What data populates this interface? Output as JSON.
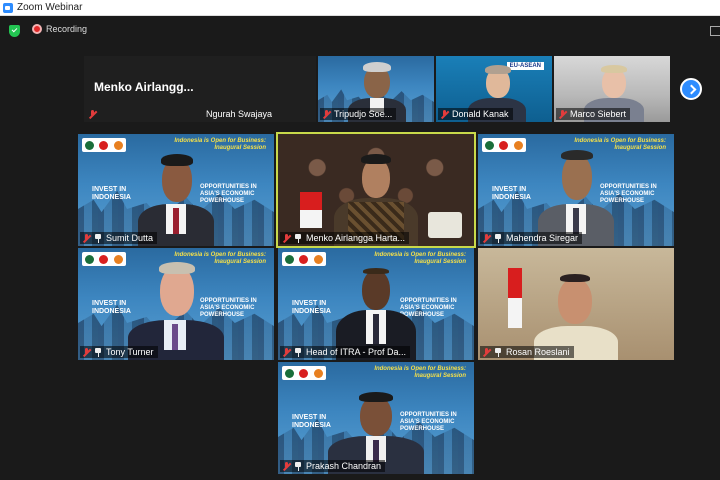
{
  "window": {
    "title": "Zoom Webinar"
  },
  "status": {
    "recording_label": "Recording"
  },
  "banner": {
    "title": "Indonesia is Open for Business: Inaugural Session",
    "left": "INVEST IN INDONESIA",
    "right": "OPPORTUNITIES IN ASIA'S ECONOMIC POWERHOUSE"
  },
  "top_strip": {
    "tiles": [
      {
        "name": "",
        "big_name": "Menko  Airlangg..."
      },
      {
        "name": "Ngurah Swajaya"
      },
      {
        "name": "Tripudjo Soe..."
      },
      {
        "name": "Donald Kanak",
        "badge": "EU-ASEAN"
      },
      {
        "name": "Marco Siebert"
      }
    ]
  },
  "gallery": {
    "tiles": [
      {
        "name": "Sumit Dutta"
      },
      {
        "name": "Menko Airlangga Harta..."
      },
      {
        "name": "Mahendra Siregar"
      },
      {
        "name": "Tony Turner"
      },
      {
        "name": "Head of ITRA - Prof Da..."
      },
      {
        "name": "Rosan Roeslani"
      },
      {
        "name": "Prakash Chandran"
      }
    ]
  },
  "colors": {
    "active_speaker": "#c8d94a",
    "zoom_blue": "#2d8cff",
    "muted_red": "#e23c3c"
  }
}
